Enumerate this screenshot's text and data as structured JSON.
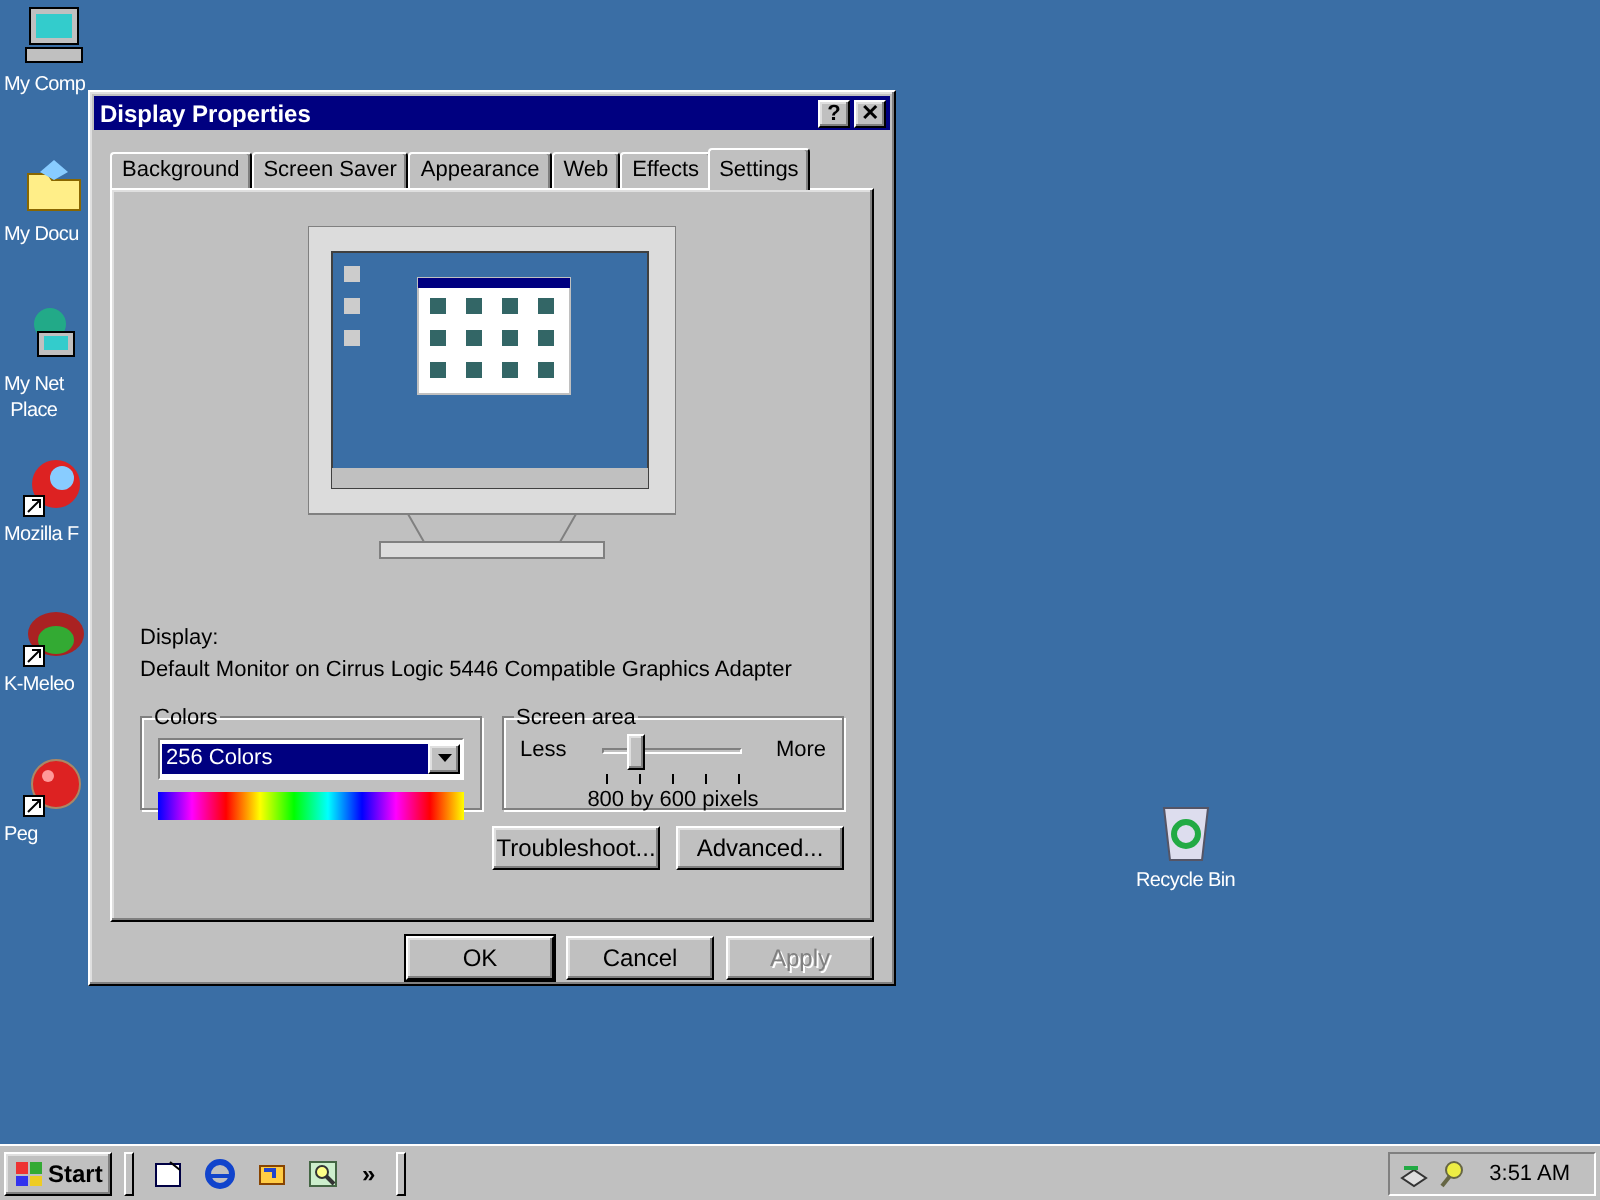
{
  "desktop_icons": [
    {
      "kind": "computer",
      "label": "My Comp",
      "shortcut": false
    },
    {
      "kind": "folder",
      "label": "My Docu",
      "shortcut": false
    },
    {
      "kind": "network",
      "label": "My Net\nPlace",
      "shortcut": false
    },
    {
      "kind": "browser",
      "label": "Mozilla F",
      "shortcut": true
    },
    {
      "kind": "lizard",
      "label": "K-Meleo",
      "shortcut": true
    },
    {
      "kind": "ball",
      "label": "Peg",
      "shortcut": true
    }
  ],
  "recycle_bin": {
    "label": "Recycle Bin"
  },
  "window": {
    "title": "Display Properties",
    "help": "?",
    "close": "✕",
    "tabs": [
      {
        "label": "Background",
        "selected": false
      },
      {
        "label": "Screen Saver",
        "selected": false
      },
      {
        "label": "Appearance",
        "selected": false
      },
      {
        "label": "Web",
        "selected": false
      },
      {
        "label": "Effects",
        "selected": false
      },
      {
        "label": "Settings",
        "selected": true
      }
    ],
    "display_label": "Display:",
    "display_value": "Default Monitor on Cirrus Logic 5446 Compatible Graphics Adapter",
    "colors": {
      "title": "Colors",
      "value": "256 Colors"
    },
    "screen_area": {
      "title": "Screen area",
      "less": "Less",
      "more": "More",
      "level": 0.25,
      "reading": "800 by 600 pixels"
    },
    "actions": [
      {
        "label": "Troubleshoot...",
        "disabled": false
      },
      {
        "label": "Advanced...",
        "disabled": false
      }
    ],
    "buttons": [
      {
        "label": "OK",
        "default": true,
        "disabled": false
      },
      {
        "label": "Cancel",
        "default": false,
        "disabled": false
      },
      {
        "label": "Apply",
        "default": false,
        "disabled": true
      }
    ]
  },
  "taskbar": {
    "start": "Start",
    "quick_launch": [
      {
        "kind": "desktop"
      },
      {
        "kind": "ie"
      },
      {
        "kind": "channels"
      },
      {
        "kind": "search"
      }
    ],
    "more": "»",
    "clock": "3:51 AM"
  }
}
